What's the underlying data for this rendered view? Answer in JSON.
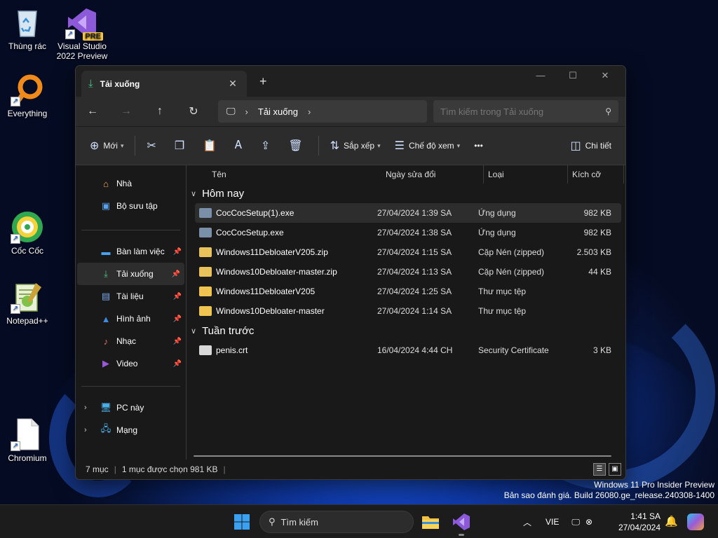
{
  "desktop": {
    "icons": [
      {
        "label": "Thùng rác",
        "icon": "recycle-bin-icon"
      },
      {
        "label": "Visual Studio 2022 Preview",
        "icon": "visual-studio-icon",
        "badge": "PRE"
      },
      {
        "label": "Everything",
        "icon": "search-magnifier-icon"
      },
      {
        "label": "Cốc Cốc",
        "icon": "coccoc-browser-icon"
      },
      {
        "label": "Notepad++",
        "icon": "notepad-plus-plus-icon"
      },
      {
        "label": "Chromium",
        "icon": "blank-file-icon"
      }
    ]
  },
  "explorer": {
    "tab_title": "Tải xuống",
    "breadcrumb": {
      "location": "Tải xuống"
    },
    "search_placeholder": "Tìm kiếm trong Tải xuống",
    "toolbar": {
      "new_label": "Mới",
      "sort_label": "Sắp xếp",
      "view_label": "Chế độ xem",
      "more_label": "•••",
      "details_label": "Chi tiết"
    },
    "nav": {
      "home": "Nhà",
      "gallery": "Bộ sưu tập",
      "pinned": [
        {
          "label": "Bàn làm việc",
          "icon": "desktop-icon",
          "color": "#4aa3f0"
        },
        {
          "label": "Tải xuống",
          "icon": "download-icon",
          "color": "#4ac28a"
        },
        {
          "label": "Tài liệu",
          "icon": "document-icon",
          "color": "#7aa7e8"
        },
        {
          "label": "Hình ảnh",
          "icon": "pictures-icon",
          "color": "#3c8be0"
        },
        {
          "label": "Nhạc",
          "icon": "music-icon",
          "color": "#e0706a"
        },
        {
          "label": "Video",
          "icon": "video-icon",
          "color": "#9a5ad8"
        }
      ],
      "this_pc": "PC này",
      "network": "Mạng"
    },
    "columns": {
      "name": "Tên",
      "date": "Ngày sửa đổi",
      "type": "Loại",
      "size": "Kích cỡ"
    },
    "groups": [
      {
        "title": "Hôm nay",
        "files": [
          {
            "name": "CocCocSetup(1).exe",
            "date": "27/04/2024 1:39 SA",
            "type": "Ứng dụng",
            "size": "982 KB",
            "kind": "exe",
            "selected": true
          },
          {
            "name": "CocCocSetup.exe",
            "date": "27/04/2024 1:38 SA",
            "type": "Ứng dụng",
            "size": "982 KB",
            "kind": "exe"
          },
          {
            "name": "Windows11DebloaterV205.zip",
            "date": "27/04/2024 1:15 SA",
            "type": "Cặp Nén (zipped)",
            "size": "2.503 KB",
            "kind": "zip"
          },
          {
            "name": "Windows10Debloater-master.zip",
            "date": "27/04/2024 1:13 SA",
            "type": "Cặp Nén (zipped)",
            "size": "44 KB",
            "kind": "zip"
          },
          {
            "name": "Windows11DebloaterV205",
            "date": "27/04/2024 1:25 SA",
            "type": "Thư mục tệp",
            "size": "",
            "kind": "folder"
          },
          {
            "name": "Windows10Debloater-master",
            "date": "27/04/2024 1:14 SA",
            "type": "Thư mục tệp",
            "size": "",
            "kind": "folder"
          }
        ]
      },
      {
        "title": "Tuần trước",
        "files": [
          {
            "name": "penis.crt",
            "date": "16/04/2024 4:44 CH",
            "type": "Security Certificate",
            "size": "3 KB",
            "kind": "cert"
          }
        ]
      }
    ],
    "status": {
      "count": "7 mục",
      "selection": "1 mục được chọn  981 KB"
    }
  },
  "watermark": {
    "line1": "Windows 11 Pro Insider Preview",
    "line2": "Bản sao đánh giá. Build 26080.ge_release.240308-1400"
  },
  "taskbar": {
    "search_label": "Tìm kiếm",
    "language": "VIE",
    "time": "1:41 SA",
    "date": "27/04/2024"
  }
}
